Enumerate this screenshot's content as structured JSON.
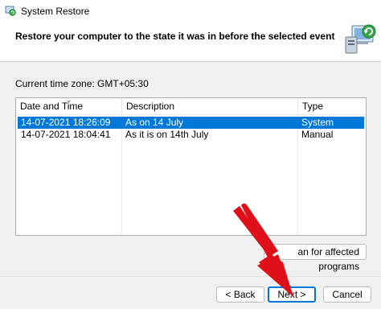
{
  "window": {
    "title": "System Restore",
    "icon": "system-restore-icon"
  },
  "header": {
    "heading": "Restore your computer to the state it was in before the selected event",
    "icon": "computer-restore-icon"
  },
  "timezone_label": "Current time zone: GMT+05:30",
  "restore_points": {
    "columns": [
      "Date and Time",
      "Description",
      "Type"
    ],
    "rows": [
      {
        "date": "14-07-2021 18:26:09",
        "description": "As on 14 July",
        "type": "System",
        "selected": true
      },
      {
        "date": "14-07-2021 18:04:41",
        "description": "As it is on 14th July",
        "type": "Manual",
        "selected": false
      }
    ]
  },
  "scan_button": {
    "label": "Scan for affected programs",
    "visible_label": "an for affected programs"
  },
  "footer": {
    "back_label": "< Back",
    "next_label": "Next >",
    "cancel_label": "Cancel"
  },
  "colors": {
    "selection": "#0078d7",
    "annotation_arrow": "#e0101a"
  }
}
